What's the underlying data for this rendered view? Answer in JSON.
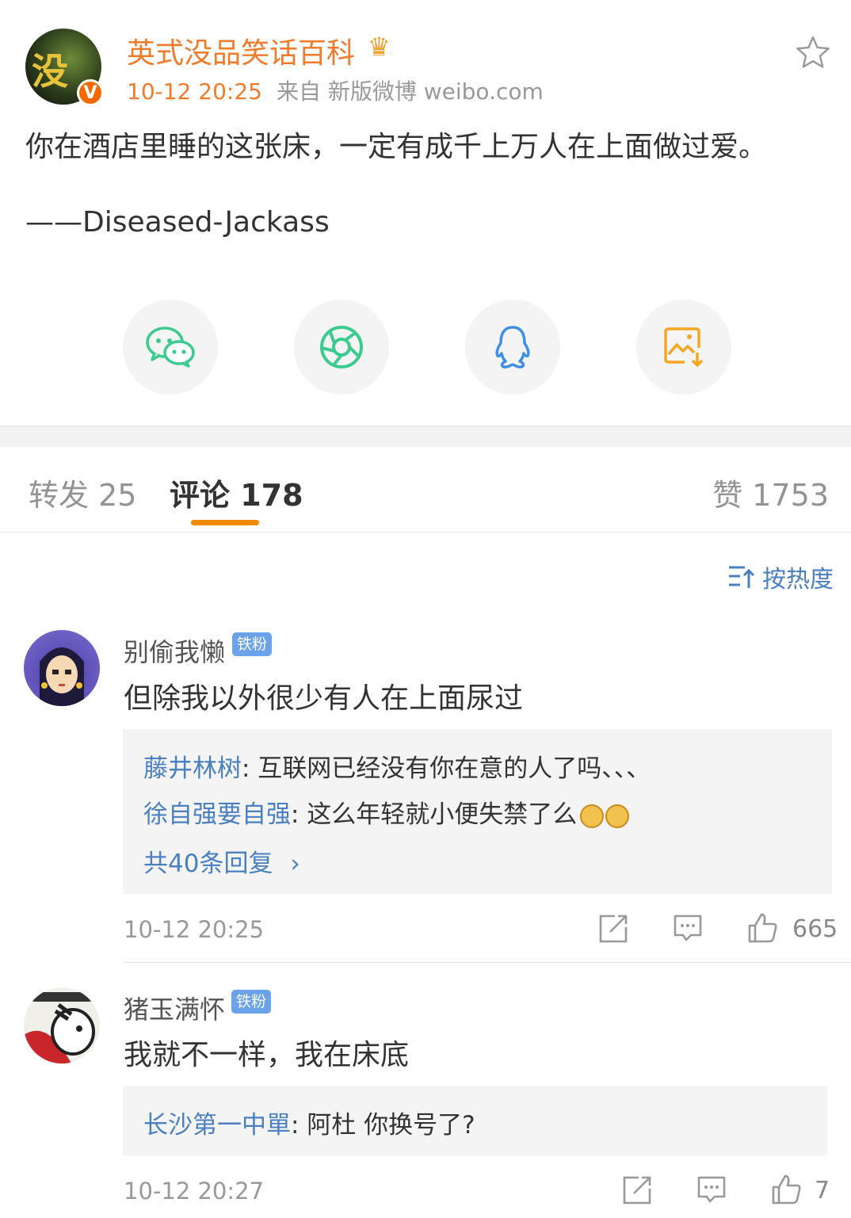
{
  "post": {
    "author": "英式没品笑话百科",
    "avatar_text": "没",
    "verified_badge": "V",
    "time": "10-12 20:25",
    "source": "来自 新版微博 weibo.com",
    "text": "你在酒店里睡的这张床，一定有成千上万人在上面做过爱。",
    "signature": "——Diseased-Jackass"
  },
  "share": [
    {
      "name": "wechat-icon",
      "color": "#3ccb8f"
    },
    {
      "name": "moments-icon",
      "color": "#3ccb8f"
    },
    {
      "name": "qq-icon",
      "color": "#3e8ee8"
    },
    {
      "name": "save-image-icon",
      "color": "#f5a623"
    }
  ],
  "tabs": {
    "repost": "转发 25",
    "comments": "评论 178",
    "likes": "赞 1753"
  },
  "sort_label": "按热度",
  "comments": [
    {
      "name": "别偷我懒",
      "badge": "铁粉",
      "text": "但除我以外很少有人在上面尿过",
      "replies": [
        {
          "name": "藤井林树",
          "text": ": 互联网已经没有你在意的人了吗、、、"
        },
        {
          "name": "徐自强要自强",
          "text": ": 这么年轻就小便失禁了么"
        }
      ],
      "more": "共40条回复",
      "time": "10-12 20:25",
      "likes": "665"
    },
    {
      "name": "猪玉满怀",
      "badge": "铁粉",
      "text": "我就不一样，我在床底",
      "replies": [
        {
          "name": "长沙第一中單",
          "text": ": 阿杜 你换号了?"
        }
      ],
      "time": "10-12 20:27",
      "likes": "7"
    }
  ]
}
